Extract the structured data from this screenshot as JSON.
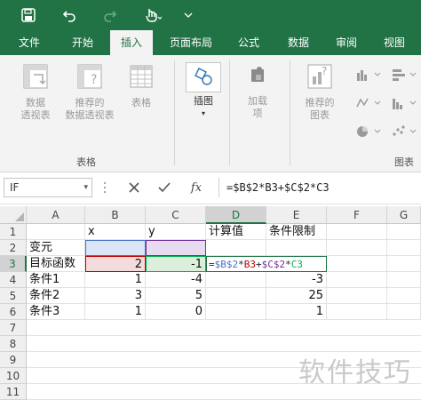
{
  "tabs": [
    {
      "label": "文件"
    },
    {
      "label": "开始"
    },
    {
      "label": "插入"
    },
    {
      "label": "页面布局"
    },
    {
      "label": "公式"
    },
    {
      "label": "数据"
    },
    {
      "label": "审阅"
    },
    {
      "label": "视图"
    }
  ],
  "active_tab": "插入",
  "ribbon": {
    "pivot_table": "数据\n透视表",
    "recommended_pivot": "推荐的\n数据透视表",
    "table": "表格",
    "group_tables": "表格",
    "illustrations": "插图",
    "addins": "加载\n项",
    "recommended_charts": "推荐的\n图表",
    "group_charts": "图表"
  },
  "formula_bar": {
    "name_box": "IF",
    "fx": "fx",
    "formula": "=$B$2*B3+$C$2*C3"
  },
  "columns": [
    "A",
    "B",
    "C",
    "D",
    "E",
    "F",
    "G"
  ],
  "rows": [
    "1",
    "2",
    "3",
    "4",
    "5",
    "6",
    "7",
    "8",
    "9",
    "10",
    "11"
  ],
  "cells": {
    "B1": "x",
    "C1": "y",
    "D1": "计算值",
    "E1": "条件限制",
    "A2": "变元",
    "A3": "目标函数",
    "B3": "2",
    "C3": "-1",
    "D3_parts": [
      "=",
      "$B$2",
      "*",
      "B3",
      "+",
      "$C$2",
      "*",
      "C3"
    ],
    "A4": "条件1",
    "B4": "1",
    "C4": "-4",
    "E4": "-3",
    "A5": "条件2",
    "B5": "3",
    "C5": "5",
    "E5": "25",
    "A6": "条件3",
    "B6": "1",
    "C6": "0",
    "E6": "1"
  },
  "colors": {
    "brand": "#217346",
    "ref_blue": "#4472c4",
    "ref_purple": "#7030a0",
    "ref_red": "#c00000",
    "ref_green": "#00b050"
  },
  "watermark": "软件技巧"
}
